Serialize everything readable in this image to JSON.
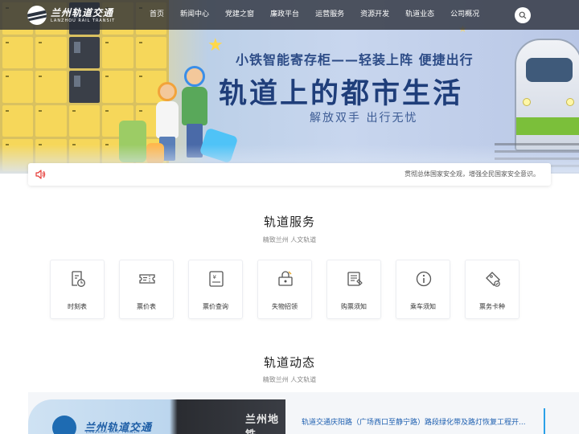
{
  "brand": {
    "name_cn": "兰州轨道交通",
    "name_en": "LANZHOU RAIL TRANSIT"
  },
  "nav": {
    "items": [
      {
        "label": "首页"
      },
      {
        "label": "新闻中心"
      },
      {
        "label": "党建之窗"
      },
      {
        "label": "廉政平台"
      },
      {
        "label": "运营服务"
      },
      {
        "label": "资源开发"
      },
      {
        "label": "轨道业态"
      },
      {
        "label": "公司概况"
      }
    ],
    "search_icon": "search-icon"
  },
  "hero": {
    "subtitle": "小铁智能寄存柜——轻装上阵  便捷出行",
    "title": "轨道上的都市生活",
    "tagline": "解放双手  出行无忧"
  },
  "notice": {
    "icon": "speaker-icon",
    "text": "贯彻总体国家安全观，增强全民国家安全意识。"
  },
  "services": {
    "title": "轨道服务",
    "subtitle": "精致兰州 人文轨道",
    "items": [
      {
        "label": "时刻表",
        "icon": "timetable-icon"
      },
      {
        "label": "票价表",
        "icon": "ticket-icon"
      },
      {
        "label": "票价查询",
        "icon": "fare-query-icon"
      },
      {
        "label": "失物招领",
        "icon": "lost-found-icon"
      },
      {
        "label": "购票须知",
        "icon": "purchase-notice-icon"
      },
      {
        "label": "乘车须知",
        "icon": "info-icon"
      },
      {
        "label": "票务卡种",
        "icon": "card-types-icon"
      }
    ]
  },
  "news": {
    "title": "轨道动态",
    "subtitle": "精致兰州 人文轨道",
    "image_brand_cn": "兰州轨道交通",
    "image_brand_en": "LANZHOU RAIL TRANSIT",
    "image_sign": "兰州地铁",
    "headline": "轨道交通庆阳路（广场西口至静宁路）路段绿化带及路灯恢复工程开..."
  },
  "colors": {
    "accent": "#1d5fb0",
    "nav_bg": "#2c303a",
    "hero_title": "#1f3e7a",
    "notice_icon": "#e53935"
  }
}
